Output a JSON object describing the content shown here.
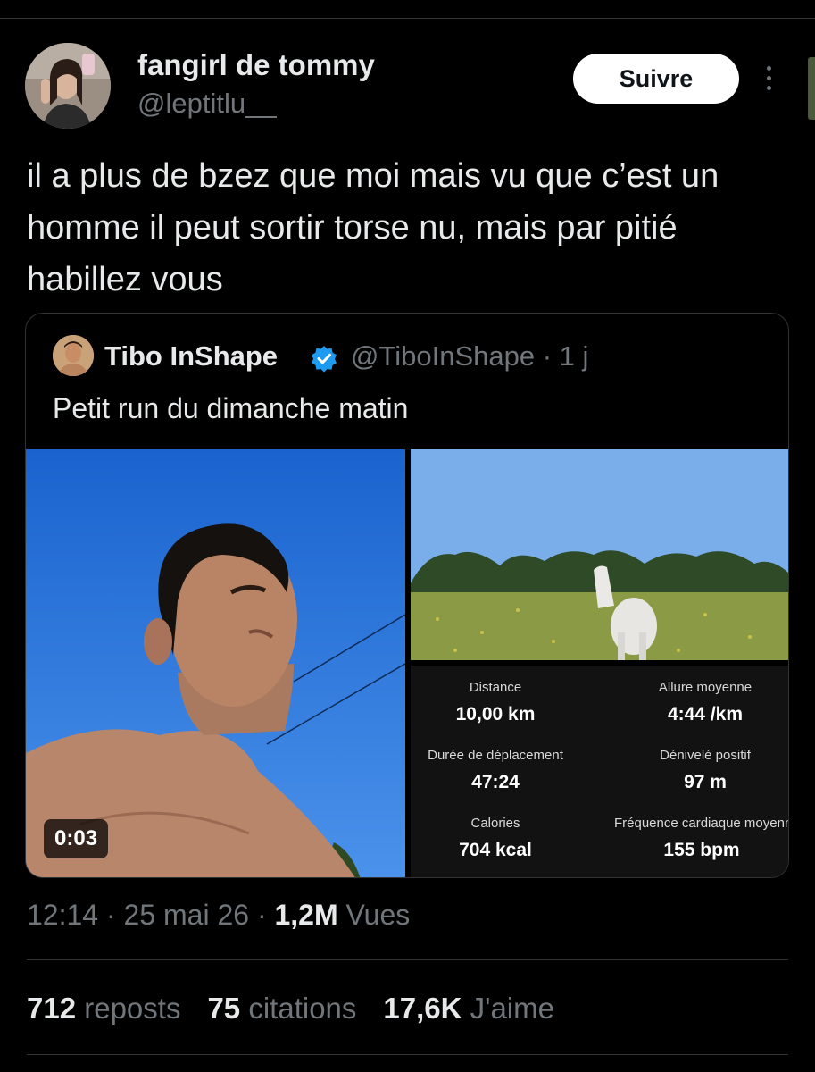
{
  "author": {
    "display_name": "fangirl de tommy",
    "handle": "@leptitlu__",
    "follow_label": "Suivre"
  },
  "tweet": {
    "text": "il a plus de bzez que moi mais vu que c’est un homme il peut sortir torse nu, mais par pitié habillez vous"
  },
  "quoted": {
    "display_name": "Tibo InShape",
    "handle_time": "@TiboInShape · 1 j",
    "text": "Petit run du dimanche matin",
    "video_time": "0:03",
    "stats": [
      {
        "label": "Distance",
        "value": "10,00 km"
      },
      {
        "label": "Allure moyenne",
        "value": "4:44 /km"
      },
      {
        "label": "Durée de déplacement",
        "value": "47:24"
      },
      {
        "label": "Dénivelé positif",
        "value": "97 m"
      },
      {
        "label": "Calories",
        "value": "704 kcal"
      },
      {
        "label": "Fréquence cardiaque moyenn",
        "value": "155 bpm"
      }
    ]
  },
  "meta": {
    "time_date": "12:14 · 25 mai 26 · ",
    "views_count": "1,2M",
    "views_label": " Vues"
  },
  "engagement": {
    "reposts_count": "712",
    "reposts_label": " reposts",
    "quotes_count": "75",
    "quotes_label": " citations",
    "likes_count": "17,6K",
    "likes_label": " J'aime"
  },
  "colors": {
    "background": "#000000",
    "text_primary": "#e7e9ea",
    "text_secondary": "#71767b",
    "divider": "#2f3336",
    "verified": "#1d9bf0"
  },
  "icons": [
    "more-options-icon",
    "verified-badge-icon"
  ]
}
